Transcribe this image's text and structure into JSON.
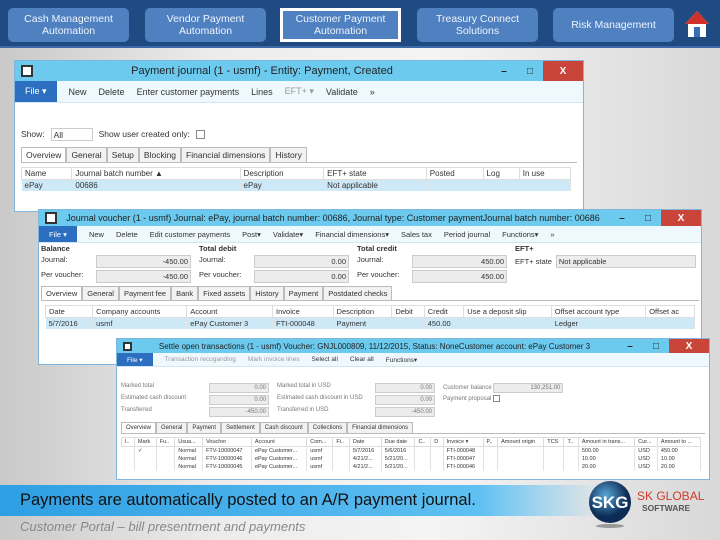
{
  "nav": [
    {
      "label": "Cash Management Automation"
    },
    {
      "label": "Vendor  Payment Automation"
    },
    {
      "label": "Customer Payment Automation"
    },
    {
      "label": "Treasury Connect Solutions"
    },
    {
      "label": "Risk Management"
    }
  ],
  "w1": {
    "title": "Payment journal (1 - usmf) - Entity: Payment, Created",
    "toolbar": [
      "File ▾",
      "New",
      "Delete",
      "Enter customer payments",
      "Lines",
      "EFT+ ▾",
      "Validate",
      "»"
    ],
    "show_label": "Show:",
    "show_value": "All",
    "user_only": "Show user created only:",
    "tabs": [
      "Overview",
      "General",
      "Setup",
      "Blocking",
      "Financial dimensions",
      "History"
    ],
    "cols": [
      "Name",
      "Journal batch number ▲",
      "Description",
      "EFT+ state",
      "Posted",
      "Log",
      "In use"
    ],
    "rows": [
      [
        "ePay",
        "00686",
        "ePay",
        "Not applicable",
        "",
        "",
        ""
      ]
    ]
  },
  "w2": {
    "title": "Journal voucher (1 - usmf)   Journal: ePay, journal batch number: 00686, Journal type: Customer paymentJournal batch number: 00686",
    "toolbar": [
      "File ▾",
      "New",
      "Delete",
      "Edit customer payments",
      "Post▾",
      "Validate▾",
      "Financial dimensions▾",
      "Sales tax",
      "Period journal",
      "Functions▾",
      "»"
    ],
    "groups": [
      {
        "h": "Balance",
        "r": [
          [
            "Journal:",
            "-450.00"
          ],
          [
            "Per voucher:",
            "-450.00"
          ]
        ]
      },
      {
        "h": "Total debit",
        "r": [
          [
            "Journal:",
            "0.00"
          ],
          [
            "Per voucher:",
            "0.00"
          ]
        ]
      },
      {
        "h": "Total credit",
        "r": [
          [
            "Journal:",
            "450.00"
          ],
          [
            "Per voucher:",
            "450.00"
          ]
        ]
      }
    ],
    "eft_h": "EFT+",
    "eft_label": "EFT+ state",
    "eft_value": "Not applicable",
    "tabs": [
      "Overview",
      "General",
      "Payment fee",
      "Bank",
      "Fixed assets",
      "History",
      "Payment",
      "Postdated checks"
    ],
    "cols": [
      "Date",
      "Company accounts",
      "Account",
      "Invoice",
      "Description",
      "Debit",
      "Credit",
      "Use a deposit slip",
      "Offset account type",
      "Offset ac"
    ],
    "rows": [
      [
        "5/7/2016",
        "usmf",
        "ePay Customer 3",
        "FTI-000048",
        "Payment",
        "",
        "450.00",
        "",
        "Ledger",
        ""
      ]
    ]
  },
  "w3": {
    "title": "Settle open transactions (1 - usmf)   Voucher: GNJL000809, 11/12/2015, Status: NoneCustomer account: ePay Customer 3",
    "toolbar": [
      "File ▾",
      "Transaction recoganding",
      "Mark invoice lines",
      "Select all",
      "Clear all",
      "Functions▾"
    ],
    "f1": [
      [
        "Marked total",
        "0.00"
      ],
      [
        "Estimated cash discount",
        "0.00"
      ],
      [
        "Transferred",
        "-450.00"
      ]
    ],
    "f2": [
      [
        "Marked total in USD",
        "0.00"
      ],
      [
        "Estimated cash discount in USD",
        "0.00"
      ],
      [
        "Transferred in USD",
        "-450.00"
      ]
    ],
    "balance_label": "Customer balance",
    "balance_value": "130,251.00",
    "proposal": "Payment proposal",
    "tabs": [
      "Overview",
      "General",
      "Payment",
      "Settlement",
      "Cash discount",
      "Collections",
      "Financial dimensions"
    ],
    "cols": [
      "I..",
      "Mark",
      "Fu..",
      "Usua...",
      "Voucher",
      "Account",
      "Com...",
      "Fi..",
      "Date",
      "Due date",
      "C..",
      "D",
      "Invoice ▾",
      "P..",
      "Amount origin",
      "TCS",
      "T..",
      "Amount in trans...",
      "Cur...",
      "Amount to ..."
    ],
    "rows": [
      [
        "",
        "✓",
        "",
        "Normal",
        "FTV-10000047",
        "ePay Customer...",
        "usmf",
        "",
        "5/7/2016",
        "5/6/2016",
        "",
        "",
        "FTI-000048",
        "",
        "",
        "",
        "",
        "500.00",
        "USD",
        "450.00"
      ],
      [
        "",
        "",
        "",
        "Normal",
        "FTV-10000046",
        "ePay Customer...",
        "usmf",
        "",
        "4/21/2...",
        "5/21/20...",
        "",
        "",
        "FTI-000047",
        "",
        "",
        "",
        "",
        "10.00",
        "USD",
        "10.00"
      ],
      [
        "",
        "",
        "",
        "Normal",
        "FTV-10000045",
        "ePay Customer...",
        "usmf",
        "",
        "4/21/2...",
        "5/21/20...",
        "",
        "",
        "FTI-000046",
        "",
        "",
        "",
        "",
        "20.00",
        "USD",
        "20.00"
      ]
    ]
  },
  "banner": "Payments are automatically posted to an A/R payment journal.",
  "subtitle": "Customer Portal – bill presentment and payments",
  "logo": {
    "mark": "SKG",
    "name": "SK GLOBAL",
    "tag": "SOFTWARE"
  },
  "colors": {
    "topbar": "#1f4b82",
    "nav": "#4f80bf",
    "titlebar": "#6ccaee",
    "banner": "#2e9fe3"
  }
}
